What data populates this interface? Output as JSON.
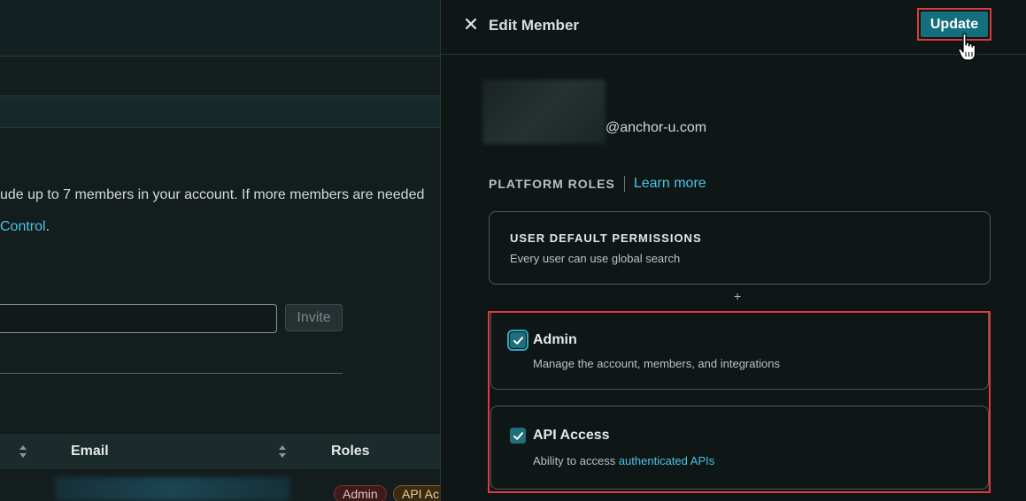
{
  "background": {
    "para_line1": "ude up to 7 members in your account. If more members are needed",
    "para_line2_link": "Control",
    "para_line2_suffix": ".",
    "invite_button": "Invite",
    "table": {
      "headers": [
        "",
        "Email",
        "Roles"
      ],
      "row_badges": [
        "Admin",
        "API Ac"
      ]
    }
  },
  "drawer": {
    "title": "Edit Member",
    "update_label": "Update",
    "email_suffix": "@anchor-u.com",
    "roles_section": {
      "label": "PLATFORM ROLES",
      "learn_more": "Learn more"
    },
    "default_permissions": {
      "title": "USER DEFAULT PERMISSIONS",
      "description": "Every user can use global search"
    },
    "plus_symbol": "+",
    "roles": [
      {
        "name": "Admin",
        "description": "Manage the account, members, and integrations",
        "checked": true
      },
      {
        "name": "API Access",
        "description_prefix": "Ability to access ",
        "description_link": "authenticated APIs",
        "checked": true
      }
    ]
  },
  "colors": {
    "accent": "#136e7d",
    "link": "#4cc3e6",
    "highlight": "#e0393f",
    "admin_badge": "#7a2f31",
    "api_badge": "#7a5522"
  },
  "icons": [
    "close-icon",
    "check-icon",
    "sort-icon",
    "hand-cursor-icon"
  ]
}
